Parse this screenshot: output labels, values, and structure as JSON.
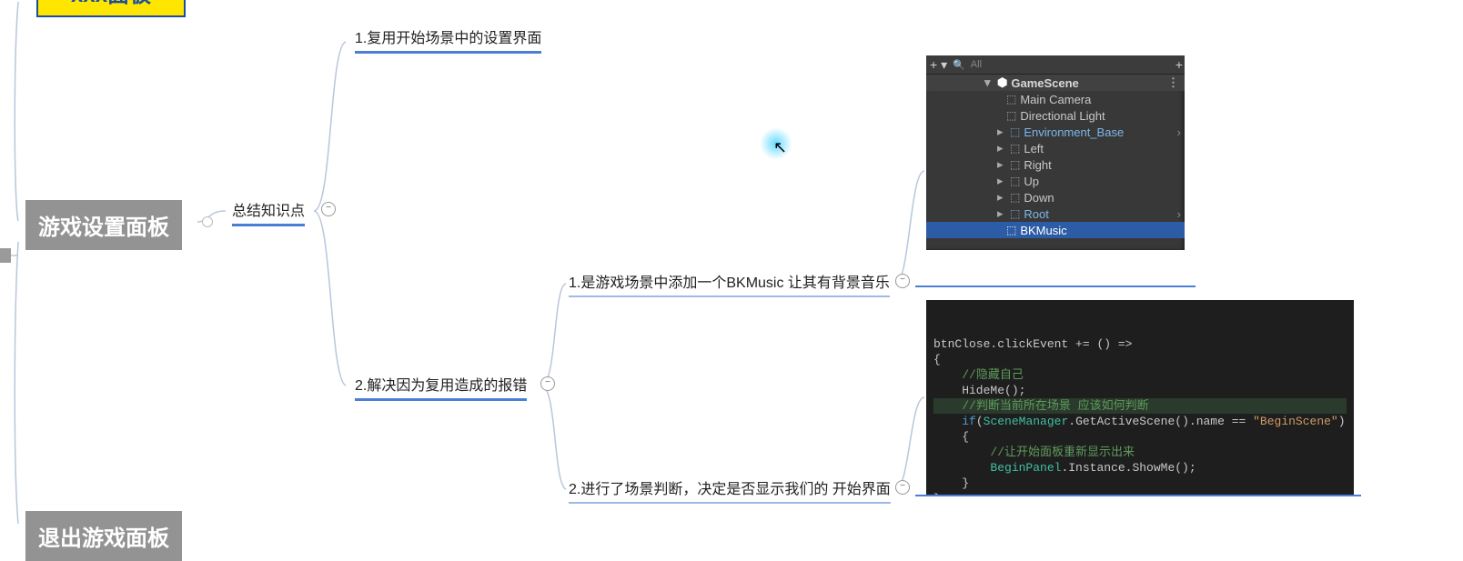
{
  "mindmap": {
    "root_top": "xxx面板",
    "main": "游戏设置面板",
    "root_bottom": "退出游戏面板",
    "branch_label": "总结知识点",
    "leaf1": "1.复用开始场景中的设置界面",
    "leaf2": "2.解决因为复用造成的报错",
    "sub1": "1.是游戏场景中添加一个BKMusic 让其有背景音乐",
    "sub2": "2.进行了场景判断，决定是否显示我们的 开始界面"
  },
  "unity": {
    "search_label": "All",
    "scene": "GameScene",
    "items": [
      {
        "label": "Main Camera",
        "indent": 2,
        "arrow": "",
        "prefab": false
      },
      {
        "label": "Directional Light",
        "indent": 2,
        "arrow": "",
        "prefab": false
      },
      {
        "label": "Environment_Base",
        "indent": 2,
        "arrow": "▸",
        "prefab": true,
        "chev": true
      },
      {
        "label": "Left",
        "indent": 2,
        "arrow": "▸",
        "prefab": false
      },
      {
        "label": "Right",
        "indent": 2,
        "arrow": "▸",
        "prefab": false
      },
      {
        "label": "Up",
        "indent": 2,
        "arrow": "▸",
        "prefab": false
      },
      {
        "label": "Down",
        "indent": 2,
        "arrow": "▸",
        "prefab": false
      },
      {
        "label": "Root",
        "indent": 2,
        "arrow": "▸",
        "prefab": true,
        "chev": true
      },
      {
        "label": "BKMusic",
        "indent": 2,
        "arrow": "",
        "prefab": false,
        "selected": true
      }
    ]
  },
  "code": {
    "lines": [
      {
        "parts": [
          {
            "t": "btnClose"
          },
          {
            "t": ".clickEvent += () =>",
            "cls": ""
          }
        ]
      },
      {
        "parts": [
          {
            "t": "{"
          }
        ]
      },
      {
        "parts": [
          {
            "t": "    "
          },
          {
            "t": "//隐藏自己",
            "cls": "c-com"
          }
        ]
      },
      {
        "parts": [
          {
            "t": "    HideMe();"
          }
        ]
      },
      {
        "parts": [
          {
            "t": ""
          }
        ]
      },
      {
        "hl": true,
        "parts": [
          {
            "t": "    "
          },
          {
            "t": "//判断当前所在场景 应该如何判断",
            "cls": "c-com"
          }
        ]
      },
      {
        "parts": [
          {
            "t": "    "
          },
          {
            "t": "if",
            "cls": "c-kw"
          },
          {
            "t": "("
          },
          {
            "t": "SceneManager",
            "cls": "c-type"
          },
          {
            "t": ".GetActiveScene().name == "
          },
          {
            "t": "\"BeginScene\"",
            "cls": "c-str"
          },
          {
            "t": ")"
          }
        ]
      },
      {
        "parts": [
          {
            "t": "    {"
          }
        ]
      },
      {
        "parts": [
          {
            "t": "        "
          },
          {
            "t": "//让开始面板重新显示出来",
            "cls": "c-com"
          }
        ]
      },
      {
        "parts": [
          {
            "t": "        "
          },
          {
            "t": "BeginPanel",
            "cls": "c-type"
          },
          {
            "t": ".Instance.ShowMe();"
          }
        ]
      },
      {
        "parts": [
          {
            "t": "    }"
          }
        ]
      },
      {
        "parts": [
          {
            "t": "};"
          }
        ]
      }
    ]
  }
}
